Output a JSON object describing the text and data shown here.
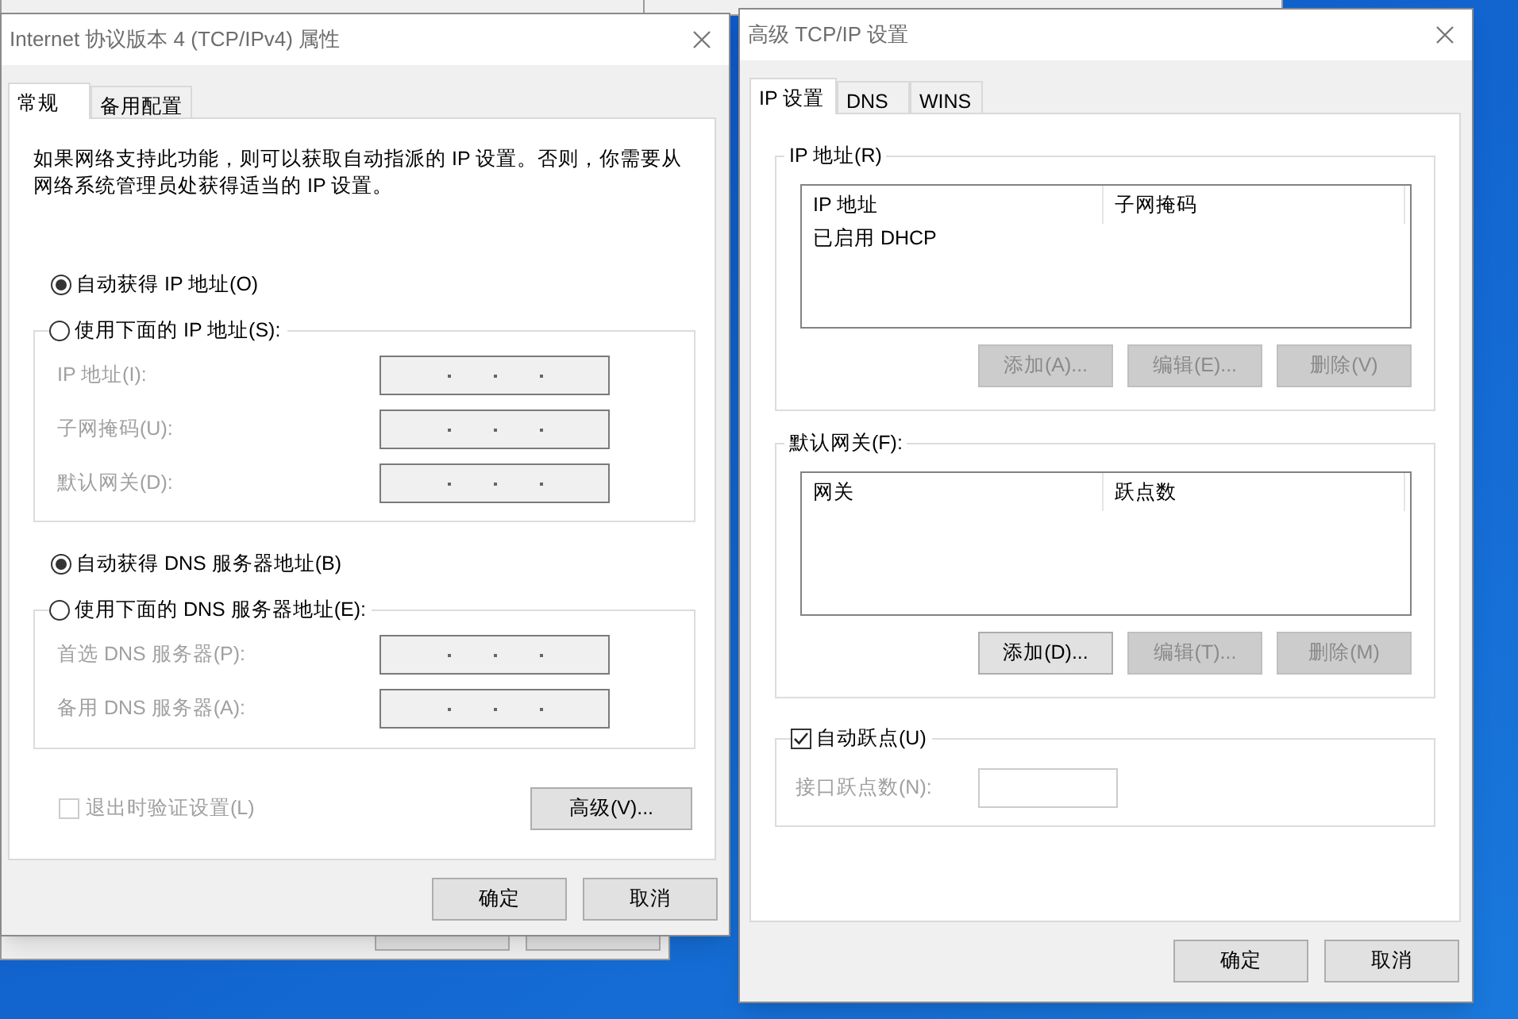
{
  "ipv4_dialog": {
    "title": "Internet 协议版本 4 (TCP/IPv4) 属性",
    "tabs": [
      {
        "label": "常规",
        "selected": true
      },
      {
        "label": "备用配置",
        "selected": false
      }
    ],
    "description": "如果网络支持此功能，则可以获取自动指派的 IP 设置。否则，你需要从网络系统管理员处获得适当的 IP 设置。",
    "ip_modes": [
      {
        "label": "自动获得 IP 地址(O)",
        "selected": true
      },
      {
        "label": "使用下面的 IP 地址(S):",
        "selected": false
      }
    ],
    "ip_fields": [
      {
        "label": "IP 地址(I):",
        "disabled": true
      },
      {
        "label": "子网掩码(U):",
        "disabled": true
      },
      {
        "label": "默认网关(D):",
        "disabled": true
      }
    ],
    "dns_modes": [
      {
        "label": "自动获得 DNS 服务器地址(B)",
        "selected": true
      },
      {
        "label": "使用下面的 DNS 服务器地址(E):",
        "selected": false
      }
    ],
    "dns_fields": [
      {
        "label": "首选 DNS 服务器(P):",
        "disabled": true
      },
      {
        "label": "备用 DNS 服务器(A):",
        "disabled": true
      }
    ],
    "validate": {
      "label": "退出时验证设置(L)",
      "checked": false,
      "disabled": true
    },
    "advanced_button": "高级(V)...",
    "buttons": [
      "确定",
      "取消"
    ]
  },
  "advanced_dialog": {
    "title": "高级 TCP/IP 设置",
    "tabs": [
      {
        "label": "IP 设置",
        "selected": true
      },
      {
        "label": "DNS",
        "selected": false
      },
      {
        "label": "WINS",
        "selected": false
      }
    ],
    "ip_group": {
      "label": "IP 地址(R)",
      "columns": [
        "IP 地址",
        "子网掩码"
      ],
      "rows": [
        [
          "已启用 DHCP"
        ]
      ],
      "buttons": [
        {
          "label": "添加(A)...",
          "disabled": true
        },
        {
          "label": "编辑(E)...",
          "disabled": true
        },
        {
          "label": "删除(V)",
          "disabled": true
        }
      ]
    },
    "gateway_group": {
      "label": "默认网关(F):",
      "columns": [
        "网关",
        "跃点数"
      ],
      "buttons": [
        {
          "label": "添加(D)...",
          "disabled": false
        },
        {
          "label": "编辑(T)...",
          "disabled": true
        },
        {
          "label": "删除(M)",
          "disabled": true
        }
      ]
    },
    "auto_metric": {
      "label": "自动跃点(U)",
      "checked": true
    },
    "metric_field": {
      "label": "接口跃点数(N):",
      "disabled": true
    },
    "buttons": [
      "确定",
      "取消"
    ]
  }
}
